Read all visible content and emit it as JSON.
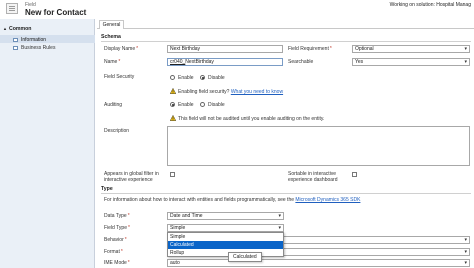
{
  "header": {
    "entity_type": "Field",
    "title": "New for Contact",
    "solution_note": "Working on solution: Hospital Manag"
  },
  "nav": {
    "group_label": "Common",
    "items": [
      {
        "label": "Information",
        "selected": true
      },
      {
        "label": "Business Rules",
        "selected": false
      }
    ]
  },
  "tabs": [
    {
      "label": "General"
    }
  ],
  "schema": {
    "section_title": "Schema",
    "display_name": {
      "label": "Display Name",
      "value": "Next Birthday"
    },
    "field_requirement": {
      "label": "Field Requirement",
      "value": "Optional"
    },
    "name": {
      "label": "Name",
      "prefix": "cr040_",
      "value": "NextBirthday"
    },
    "searchable": {
      "label": "Searchable",
      "value": "Yes"
    },
    "field_security": {
      "label": "Field Security",
      "options": [
        "Enable",
        "Disable"
      ],
      "selected": "Disable"
    },
    "field_security_note": {
      "text": "Enabling field security?",
      "link": "What you need to know"
    },
    "auditing": {
      "label": "Auditing",
      "options": [
        "Enable",
        "Disable"
      ],
      "selected": "Enable"
    },
    "auditing_note": "This field will not be audited until you enable auditing on the entity.",
    "description": {
      "label": "Description",
      "value": ""
    },
    "global_filter": {
      "label_line1": "Appears in global filter in",
      "label_line2": "interactive experience",
      "checked": false
    },
    "sortable": {
      "label_line1": "Sortable in interactive",
      "label_line2": "experience dashboard",
      "checked": false
    }
  },
  "type": {
    "section_title": "Type",
    "info_text": "For information about how to interact with entities and fields programmatically, see the",
    "info_link": "Microsoft Dynamics 365 SDK",
    "data_type": {
      "label": "Data Type",
      "value": "Date and Time"
    },
    "field_type": {
      "label": "Field Type",
      "value": "Simple"
    },
    "behavior": {
      "label": "Behavior"
    },
    "format": {
      "label": "Format"
    },
    "ime_mode": {
      "label": "IME Mode",
      "value": "auto"
    }
  },
  "field_type_dropdown": {
    "options": [
      "Simple",
      "Calculated",
      "Rollup"
    ],
    "highlighted": "Calculated"
  },
  "tooltip": "Calculated",
  "colors": {
    "required": "#c0392b",
    "link": "#1f5fbf",
    "highlight": "#0a64c8",
    "nav_bg": "#eaf0f7"
  }
}
